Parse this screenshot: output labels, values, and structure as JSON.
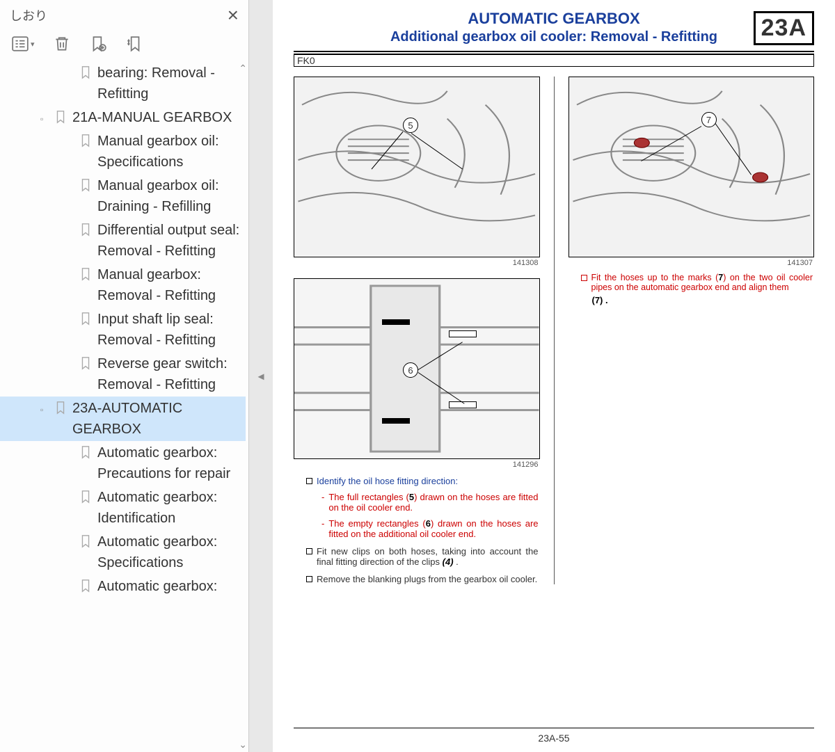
{
  "sidebar": {
    "title": "しおり",
    "items": [
      {
        "label": "bearing: Removal - Refitting",
        "indent": 2,
        "active": false,
        "twisty": ""
      },
      {
        "label": "21A-MANUAL GEARBOX",
        "indent": 1,
        "active": false,
        "twisty": "▫"
      },
      {
        "label": "Manual gearbox oil: Specifications",
        "indent": 2,
        "active": false,
        "twisty": ""
      },
      {
        "label": "Manual gearbox oil: Draining - Refilling",
        "indent": 2,
        "active": false,
        "twisty": ""
      },
      {
        "label": "Differential output seal: Removal - Refitting",
        "indent": 2,
        "active": false,
        "twisty": ""
      },
      {
        "label": "Manual gearbox: Removal - Refitting",
        "indent": 2,
        "active": false,
        "twisty": ""
      },
      {
        "label": "Input shaft lip seal: Removal - Refitting",
        "indent": 2,
        "active": false,
        "twisty": ""
      },
      {
        "label": "Reverse gear switch: Removal - Refitting",
        "indent": 2,
        "active": false,
        "twisty": ""
      },
      {
        "label": "23A-AUTOMATIC GEARBOX",
        "indent": 1,
        "active": true,
        "twisty": "▫"
      },
      {
        "label": "Automatic gearbox: Precautions for repair",
        "indent": 2,
        "active": false,
        "twisty": ""
      },
      {
        "label": "Automatic gearbox: Identification",
        "indent": 2,
        "active": false,
        "twisty": ""
      },
      {
        "label": "Automatic gearbox: Specifications",
        "indent": 2,
        "active": false,
        "twisty": ""
      },
      {
        "label": "Automatic gearbox:",
        "indent": 2,
        "active": false,
        "twisty": ""
      }
    ]
  },
  "page": {
    "section_title": "AUTOMATIC GEARBOX",
    "subtitle": "Additional gearbox oil cooler: Removal - Refitting",
    "section_code": "23A",
    "model": "FK0",
    "fig1_num": "141308",
    "fig2_num": "141296",
    "fig3_num": "141307",
    "callout5": "5",
    "callout6": "6",
    "callout7": "7",
    "text": {
      "b1": "Identify the oil hose fitting direction:",
      "s1a": "The full rectangles (",
      "s1b": ") drawn on the hoses are fitted on the oil cooler end.",
      "s2a": "The empty rectangles (",
      "s2b": ") drawn on the hoses are fitted on the additional oil cooler end.",
      "b2a": "Fit new clips on both hoses, taking into account the final fitting direction of the clips ",
      "b2b": " .",
      "b3": "Remove the blanking plugs from the gearbox oil cooler.",
      "r1a": "Fit the hoses up to the marks (",
      "r1b": ") on the two oil cooler pipes on the automatic gearbox end and align them",
      "r2": "(7) .",
      "ref5": "5",
      "ref6": "6",
      "ref4": "(4)",
      "ref7": "7"
    },
    "footer": "23A-55"
  }
}
